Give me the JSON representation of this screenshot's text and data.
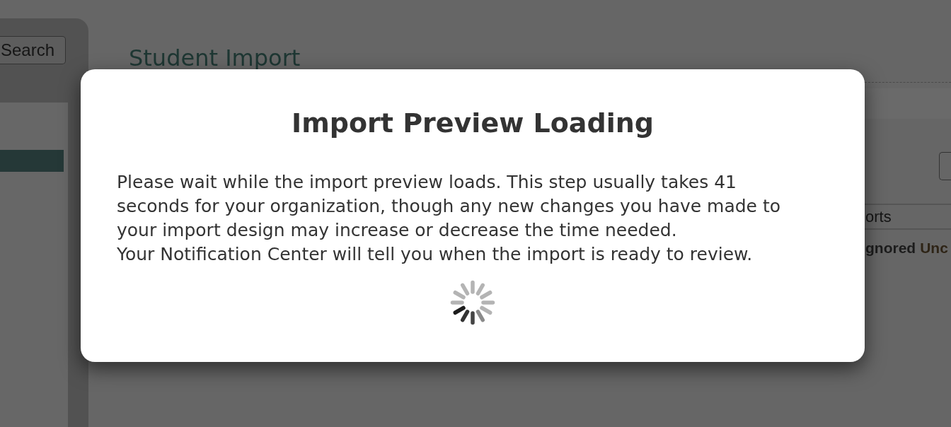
{
  "sidebar": {
    "search_button": "Search",
    "menu_items": [
      {
        "selected": true
      }
    ]
  },
  "page": {
    "title": "Student Import",
    "table": {
      "column_header": "orts",
      "legend": [
        {
          "label": "gnored",
          "color": "#1c1c1c"
        },
        {
          "label": "Unc",
          "color": "#2e2416"
        }
      ]
    }
  },
  "dialog": {
    "title": "Import Preview Loading",
    "message": "Please wait while the import preview loads. This step usually takes 41 seconds for your organization, though any new changes you have made to your import design may increase or decrease the time needed.",
    "note": "Your Notification Center will tell you when the import is ready to review."
  }
}
